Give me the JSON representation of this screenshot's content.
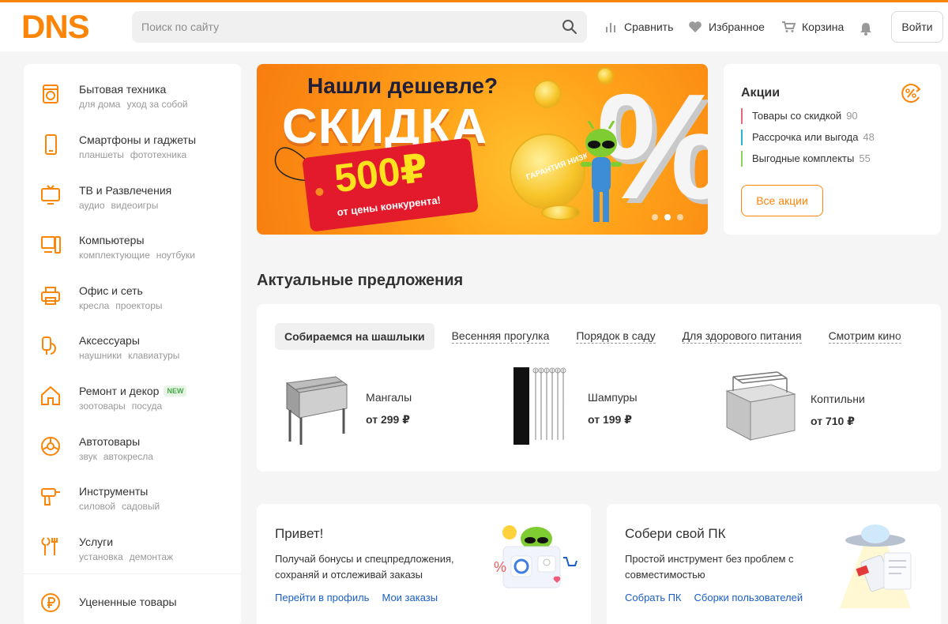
{
  "header": {
    "logo": "DNS",
    "search_placeholder": "Поиск по сайту",
    "compare": "Сравнить",
    "favorites": "Избранное",
    "cart": "Корзина",
    "login": "Войти",
    "accent_color": "#fc8507"
  },
  "menu": {
    "items": [
      {
        "title": "Бытовая техника",
        "subs": [
          "для дома",
          "уход за собой"
        ],
        "icon": "home-appliance-icon"
      },
      {
        "title": "Смартфоны и гаджеты",
        "subs": [
          "планшеты",
          "фототехника"
        ],
        "icon": "smartphone-icon"
      },
      {
        "title": "ТВ и Развлечения",
        "subs": [
          "аудио",
          "видеоигры"
        ],
        "icon": "tv-icon"
      },
      {
        "title": "Компьютеры",
        "subs": [
          "комплектующие",
          "ноутбуки"
        ],
        "icon": "computer-icon"
      },
      {
        "title": "Офис и сеть",
        "subs": [
          "кресла",
          "проекторы"
        ],
        "icon": "printer-icon"
      },
      {
        "title": "Аксессуары",
        "subs": [
          "наушники",
          "клавиатуры"
        ],
        "icon": "accessories-icon"
      },
      {
        "title": "Ремонт и декор",
        "badge": "NEW",
        "subs": [
          "зоотовары",
          "посуда"
        ],
        "icon": "house-icon"
      },
      {
        "title": "Автотовары",
        "subs": [
          "звук",
          "автокресла"
        ],
        "icon": "wheel-icon"
      },
      {
        "title": "Инструменты",
        "subs": [
          "силовой",
          "садовый"
        ],
        "icon": "drill-icon"
      },
      {
        "title": "Услуги",
        "subs": [
          "установка",
          "демонтаж"
        ],
        "icon": "wrench-icon"
      }
    ],
    "discounted": {
      "title": "Уцененные товары",
      "icon": "ruble-coin-icon"
    }
  },
  "banner": {
    "headline": "Нашли дешевле?",
    "big": "СКИДКА",
    "price": "500₽",
    "sub": "от цены конкурента!",
    "coin_text": "ГАРАНТИЯ НИЗКИХ ЦЕН"
  },
  "promo": {
    "title": "Акции",
    "rows": [
      {
        "label": "Товары со скидкой",
        "count": "90",
        "color": "#e8667a"
      },
      {
        "label": "Рассрочка или выгода",
        "count": "48",
        "color": "#25b5d6"
      },
      {
        "label": "Выгодные комплекты",
        "count": "55",
        "color": "#8fd05b"
      }
    ],
    "button": "Все акции"
  },
  "offers": {
    "title": "Актуальные предложения",
    "tabs": [
      "Собираемся на шашлыки",
      "Весенняя прогулка",
      "Порядок в саду",
      "Для здорового питания",
      "Смотрим кино"
    ],
    "products": [
      {
        "name": "Мангалы",
        "price": "от 299 ₽"
      },
      {
        "name": "Шампуры",
        "price": "от 199 ₽"
      },
      {
        "name": "Коптильни",
        "price": "от 710 ₽"
      }
    ]
  },
  "cards": {
    "hello": {
      "title": "Привет!",
      "text": "Получай бонусы и спецпредложения, сохраняй и отслеживай заказы",
      "links": [
        "Перейти в профиль",
        "Мои заказы"
      ]
    },
    "pc": {
      "title": "Собери свой ПК",
      "text": "Простой инструмент без проблем с совместимостью",
      "links": [
        "Собрать ПК",
        "Сборки пользователей"
      ]
    }
  }
}
